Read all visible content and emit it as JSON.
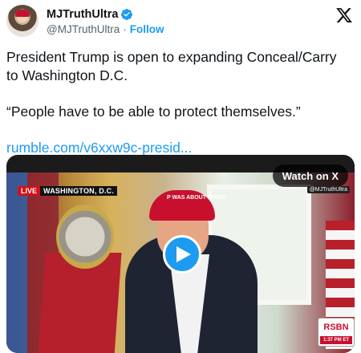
{
  "tweet": {
    "author": {
      "display_name": "MJTruthUltra",
      "handle": "@MJTruthUltra",
      "separator": "·",
      "follow_label": "Follow",
      "verified": true,
      "avatar_icon": "avatar-image"
    },
    "platform_icon": "x-logo-icon",
    "text_line1": "President Trump is open to expanding Conceal/Carry to Washington D.C.",
    "text_line2": "“People have to be able to protect themselves.”",
    "link": "rumble.com/v6xxw9c-presid..."
  },
  "media": {
    "watch_on_x_label": "Watch on X",
    "live_tag": "LIVE",
    "location": "WASHINGTON, D.C.",
    "hat_text": "P WAS ABOUT THING!",
    "credit_small": "@MJTruthUltra",
    "network_logo": "RSBN",
    "network_time": "1:37 PM ET",
    "play_icon": "play-icon"
  },
  "colors": {
    "accent": "#1d9bf0",
    "text": "#0f1419",
    "muted": "#536471",
    "live_red": "#d0121b"
  }
}
